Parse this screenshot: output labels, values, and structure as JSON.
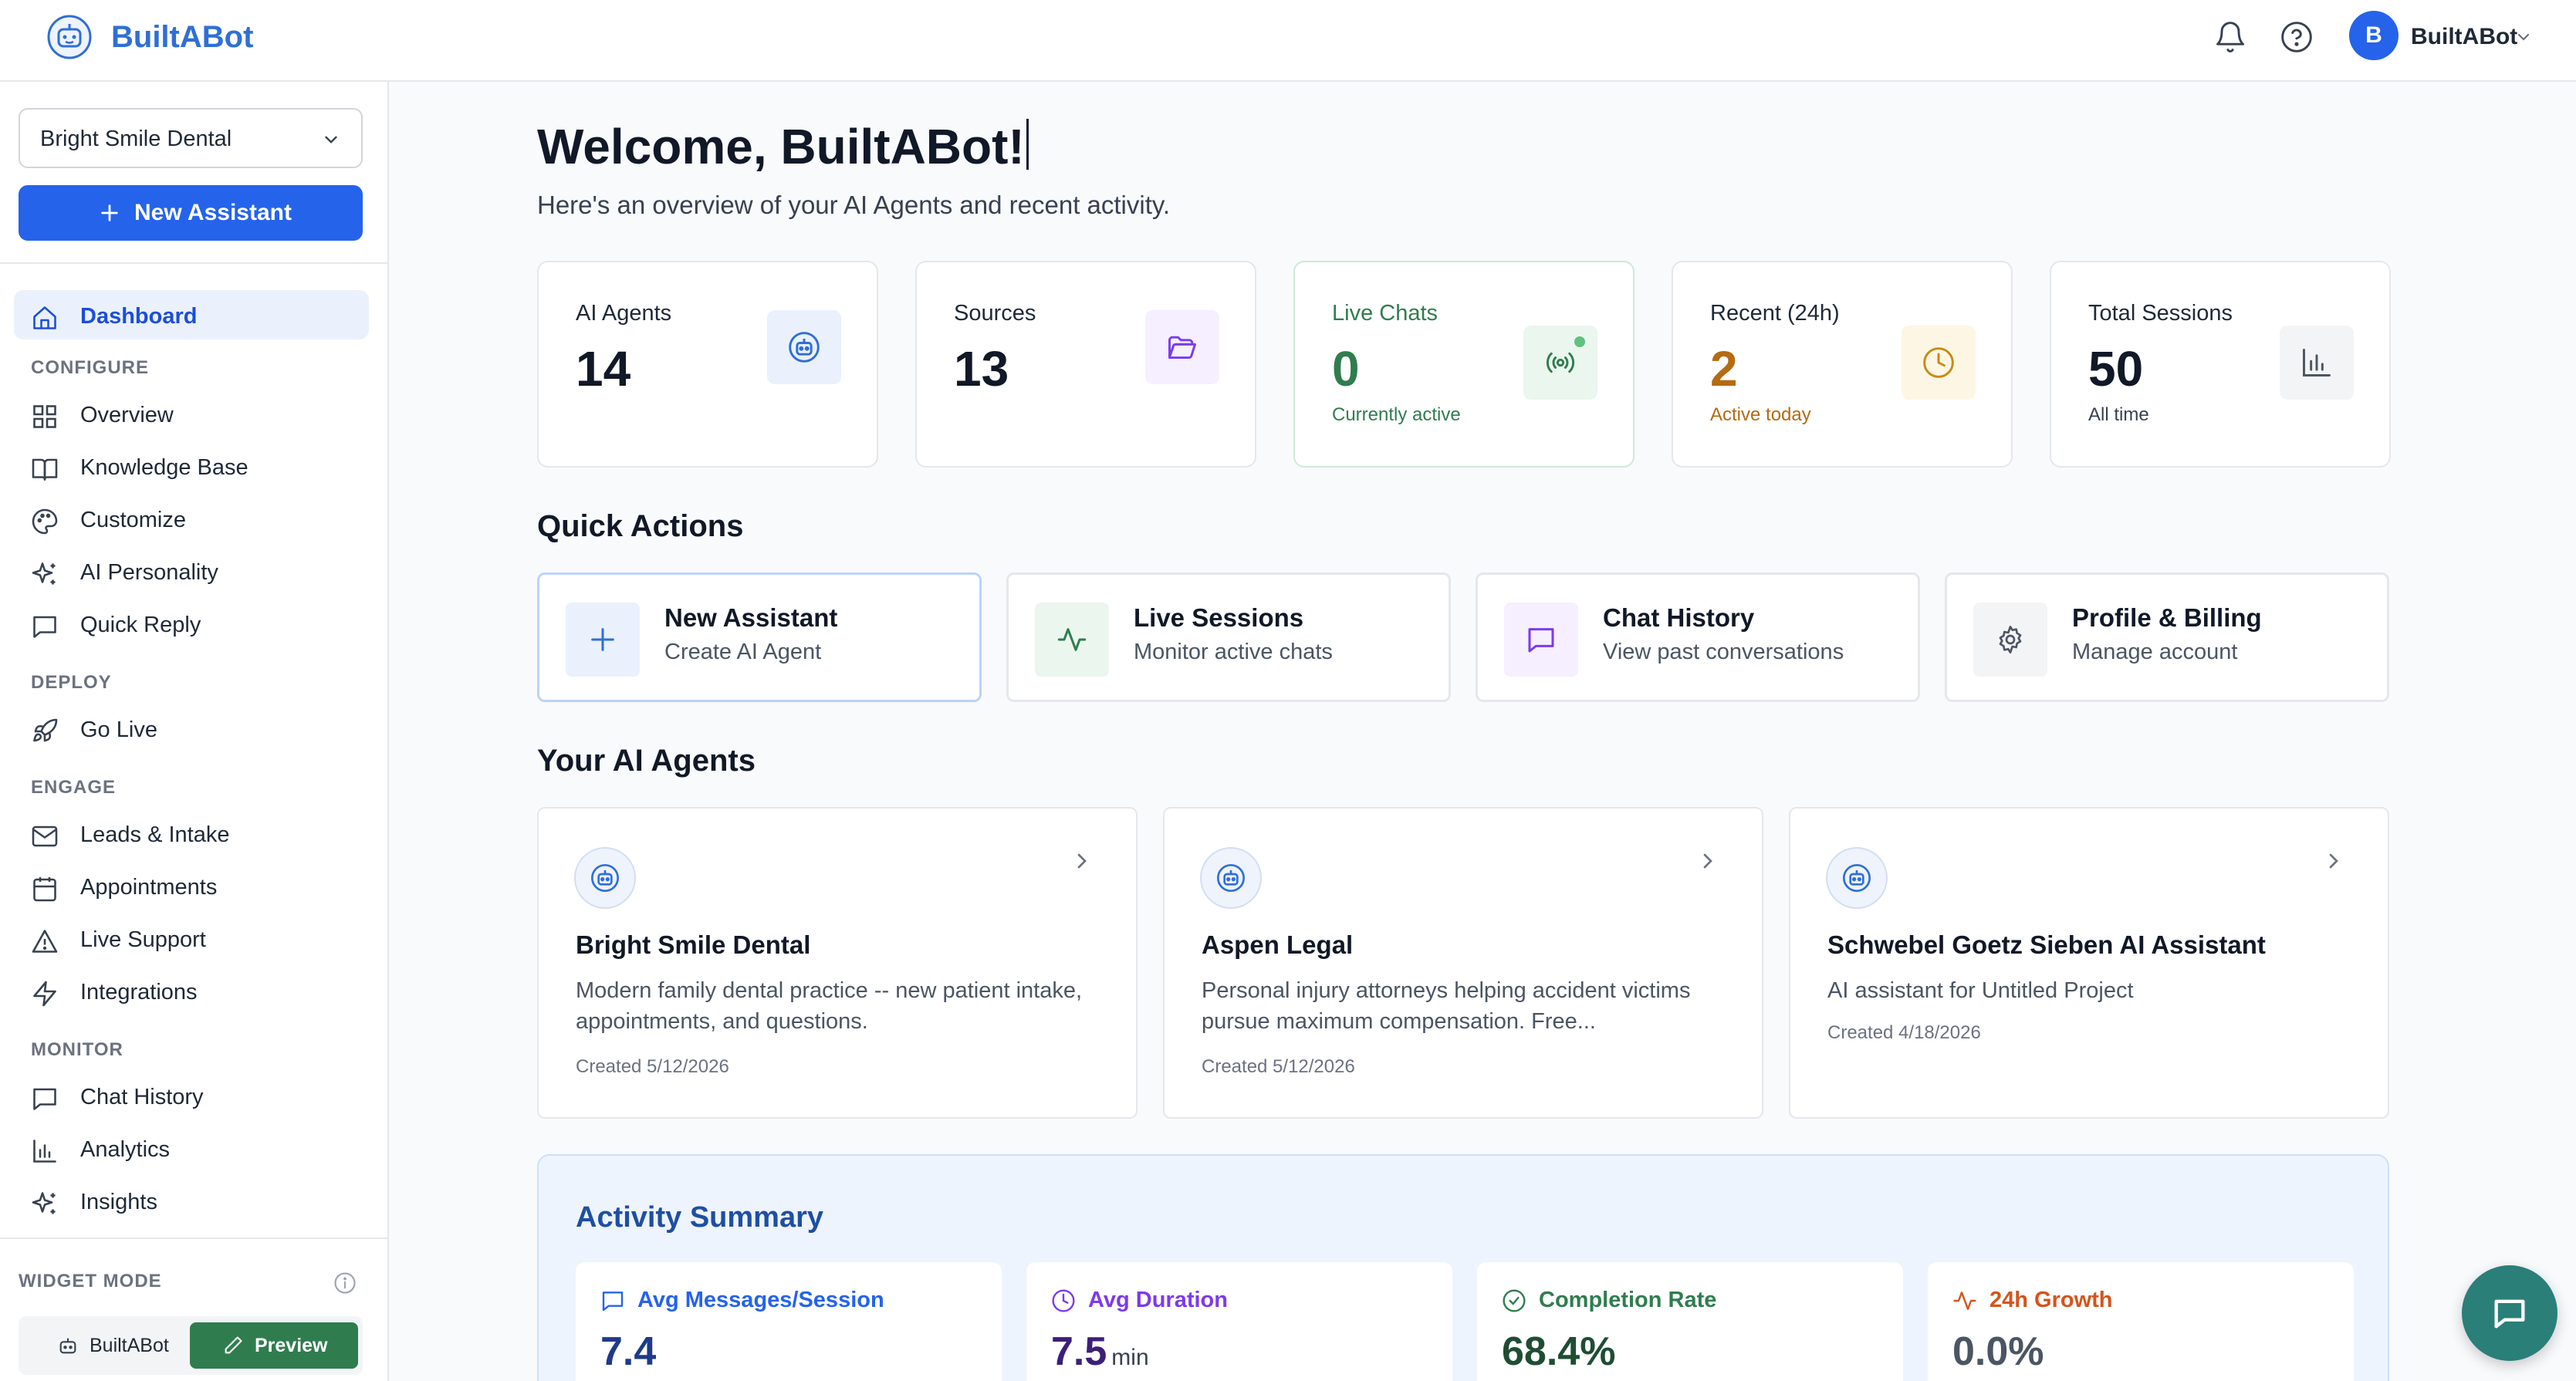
{
  "app": {
    "name": "BuiltABot",
    "user_initial": "B",
    "user_name": "BuiltABot"
  },
  "sidebar": {
    "org_select": "Bright Smile Dental",
    "new_assistant": "New Assistant",
    "dashboard": "Dashboard",
    "sections": {
      "configure": "CONFIGURE",
      "deploy": "DEPLOY",
      "engage": "ENGAGE",
      "monitor": "MONITOR"
    },
    "configure_items": [
      {
        "label": "Overview",
        "icon": "grid-icon"
      },
      {
        "label": "Knowledge Base",
        "icon": "book-icon"
      },
      {
        "label": "Customize",
        "icon": "palette-icon"
      },
      {
        "label": "AI Personality",
        "icon": "sparkles-icon"
      },
      {
        "label": "Quick Reply",
        "icon": "message-square-icon"
      }
    ],
    "deploy_items": [
      {
        "label": "Go Live",
        "icon": "rocket-icon"
      }
    ],
    "engage_items": [
      {
        "label": "Leads & Intake",
        "icon": "mail-icon"
      },
      {
        "label": "Appointments",
        "icon": "calendar-icon"
      },
      {
        "label": "Live Support",
        "icon": "alert-triangle-icon"
      },
      {
        "label": "Integrations",
        "icon": "zap-icon"
      }
    ],
    "monitor_items": [
      {
        "label": "Chat History",
        "icon": "message-square-icon"
      },
      {
        "label": "Analytics",
        "icon": "bar-chart-icon"
      },
      {
        "label": "Insights",
        "icon": "sparkles-icon"
      }
    ],
    "widget_mode": {
      "label": "WIDGET MODE",
      "option_a": "BuiltABot",
      "option_b": "Preview"
    }
  },
  "main": {
    "welcome": "Welcome, BuiltABot!",
    "subtitle": "Here's an overview of your AI Agents and recent activity.",
    "stats": [
      {
        "title": "AI Agents",
        "value": "14",
        "sub": ""
      },
      {
        "title": "Sources",
        "value": "13",
        "sub": ""
      },
      {
        "title": "Live Chats",
        "value": "0",
        "sub": "Currently active"
      },
      {
        "title": "Recent (24h)",
        "value": "2",
        "sub": "Active today"
      },
      {
        "title": "Total Sessions",
        "value": "50",
        "sub": "All time"
      }
    ],
    "quick_actions_title": "Quick Actions",
    "quick_actions": [
      {
        "title": "New Assistant",
        "sub": "Create AI Agent"
      },
      {
        "title": "Live Sessions",
        "sub": "Monitor active chats"
      },
      {
        "title": "Chat History",
        "sub": "View past conversations"
      },
      {
        "title": "Profile & Billing",
        "sub": "Manage account"
      }
    ],
    "agents_title": "Your AI Agents",
    "agents": [
      {
        "name": "Bright Smile Dental",
        "desc": "Modern family dental practice -- new patient intake, appointments, and questions.",
        "created": "Created 5/12/2026"
      },
      {
        "name": "Aspen Legal",
        "desc": "Personal injury attorneys helping accident victims pursue maximum compensation. Free...",
        "created": "Created 5/12/2026"
      },
      {
        "name": "Schwebel Goetz Sieben AI Assistant",
        "desc": "AI assistant for Untitled Project",
        "created": "Created 4/18/2026"
      }
    ],
    "activity": {
      "title": "Activity Summary",
      "metrics": [
        {
          "label": "Avg Messages/Session",
          "value": "7.4",
          "unit": "",
          "color": "#2563eb"
        },
        {
          "label": "Avg Duration",
          "value": "7.5",
          "unit": "min",
          "color": "#7c3aed"
        },
        {
          "label": "Completion Rate",
          "value": "68.4%",
          "unit": "",
          "color": "#2f7d4f"
        },
        {
          "label": "24h Growth",
          "value": "0.0%",
          "unit": "",
          "color": "#d4541c"
        }
      ]
    }
  },
  "colors": {
    "brand": "#2f6fd6",
    "primary": "#2563eb",
    "success": "#2f7d4f",
    "warning": "#b46b12",
    "fab": "#2a7f78"
  }
}
